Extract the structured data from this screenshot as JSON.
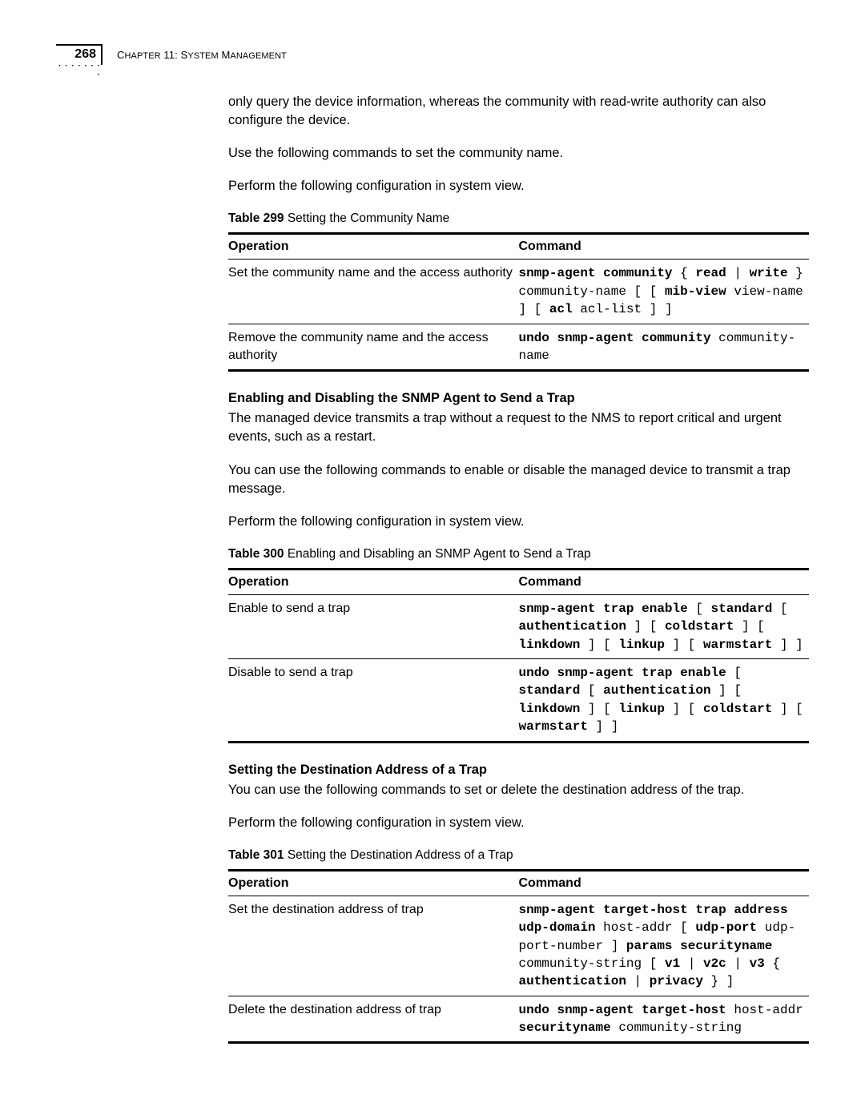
{
  "header": {
    "page_number": "268",
    "chapter_prefix": "C",
    "chapter_rest": "HAPTER",
    "chapter_num": " 11: S",
    "chapter_rest2": "YSTEM",
    "chapter_rest3": " M",
    "chapter_rest4": "ANAGEMENT"
  },
  "intro": {
    "p1": "only query the device information, whereas the community with read-write authority can also configure the device.",
    "p2": "Use the following commands to set the community name.",
    "p3": "Perform the following configuration in system view."
  },
  "table299": {
    "caption_bold": "Table 299",
    "caption_rest": "   Setting the Community Name",
    "col1": "Operation",
    "col2": "Command",
    "rows": [
      {
        "op": "Set the community name and the access authority",
        "cmd_parts": [
          {
            "t": "snmp-agent community",
            "b": true
          },
          {
            "t": " { ",
            "b": false
          },
          {
            "t": "read",
            "b": true
          },
          {
            "t": " | ",
            "b": false
          },
          {
            "t": "write",
            "b": true
          },
          {
            "t": " } community-name [ [ ",
            "b": false
          },
          {
            "t": "mib-view",
            "b": true
          },
          {
            "t": " view-name ] [ ",
            "b": false
          },
          {
            "t": "acl",
            "b": true
          },
          {
            "t": " acl-list ] ]",
            "b": false
          }
        ]
      },
      {
        "op": "Remove the community name and the access authority",
        "cmd_parts": [
          {
            "t": "undo snmp-agent community",
            "b": true
          },
          {
            "t": " community-name",
            "b": false
          }
        ]
      }
    ]
  },
  "section2": {
    "heading": "Enabling and Disabling the SNMP Agent to Send a Trap",
    "p1": "The managed device transmits a trap without a request to the NMS to report critical and urgent events, such as a restart.",
    "p2": "You can use the following commands to enable or disable the managed device to transmit a trap message.",
    "p3": "Perform the following configuration in system view."
  },
  "table300": {
    "caption_bold": "Table 300",
    "caption_rest": "   Enabling and Disabling an SNMP Agent to Send a Trap",
    "col1": "Operation",
    "col2": "Command",
    "rows": [
      {
        "op": "Enable to send a trap",
        "cmd_parts": [
          {
            "t": "snmp-agent trap enable",
            "b": true
          },
          {
            "t": " [ ",
            "b": false
          },
          {
            "t": "standard",
            "b": true
          },
          {
            "t": " [ ",
            "b": false
          },
          {
            "t": "authentication",
            "b": true
          },
          {
            "t": " ] [ ",
            "b": false
          },
          {
            "t": "coldstart",
            "b": true
          },
          {
            "t": " ] [ ",
            "b": false
          },
          {
            "t": "linkdown",
            "b": true
          },
          {
            "t": " ] [ ",
            "b": false
          },
          {
            "t": "linkup",
            "b": true
          },
          {
            "t": " ] [ ",
            "b": false
          },
          {
            "t": "warmstart",
            "b": true
          },
          {
            "t": " ] ]",
            "b": false
          }
        ]
      },
      {
        "op": "Disable to send a trap",
        "cmd_parts": [
          {
            "t": "undo snmp-agent trap enable",
            "b": true
          },
          {
            "t": " [ ",
            "b": false
          },
          {
            "t": "standard",
            "b": true
          },
          {
            "t": " [ ",
            "b": false
          },
          {
            "t": "authentication",
            "b": true
          },
          {
            "t": " ] [ ",
            "b": false
          },
          {
            "t": "linkdown",
            "b": true
          },
          {
            "t": " ] [ ",
            "b": false
          },
          {
            "t": "linkup",
            "b": true
          },
          {
            "t": " ] [ ",
            "b": false
          },
          {
            "t": "coldstart",
            "b": true
          },
          {
            "t": " ] [ ",
            "b": false
          },
          {
            "t": "warmstart",
            "b": true
          },
          {
            "t": " ] ]",
            "b": false
          }
        ]
      }
    ]
  },
  "section3": {
    "heading": "Setting the Destination Address of a Trap",
    "p1": "You can use the following commands to set or delete the destination address of the trap.",
    "p2": "Perform the following configuration in system view."
  },
  "table301": {
    "caption_bold": "Table 301",
    "caption_rest": "   Setting the Destination Address of a Trap",
    "col1": "Operation",
    "col2": "Command",
    "rows": [
      {
        "op": "Set the destination address of trap",
        "cmd_parts": [
          {
            "t": "snmp-agent target-host trap address udp-domain",
            "b": true
          },
          {
            "t": " host-addr [ ",
            "b": false
          },
          {
            "t": "udp-port",
            "b": true
          },
          {
            "t": " udp-port-number ] ",
            "b": false
          },
          {
            "t": "params securityname",
            "b": true
          },
          {
            "t": " community-string [ ",
            "b": false
          },
          {
            "t": "v1",
            "b": true
          },
          {
            "t": " | ",
            "b": false
          },
          {
            "t": "v2c",
            "b": true
          },
          {
            "t": " | ",
            "b": false
          },
          {
            "t": "v3",
            "b": true
          },
          {
            "t": " { ",
            "b": false
          },
          {
            "t": "authentication",
            "b": true
          },
          {
            "t": " | ",
            "b": false
          },
          {
            "t": "privacy",
            "b": true
          },
          {
            "t": " } ]",
            "b": false
          }
        ]
      },
      {
        "op": "Delete the destination address of trap",
        "cmd_parts": [
          {
            "t": "undo snmp-agent target-host",
            "b": true
          },
          {
            "t": " host-addr ",
            "b": false
          },
          {
            "t": "securityname",
            "b": true
          },
          {
            "t": " community-string",
            "b": false
          }
        ]
      }
    ]
  }
}
